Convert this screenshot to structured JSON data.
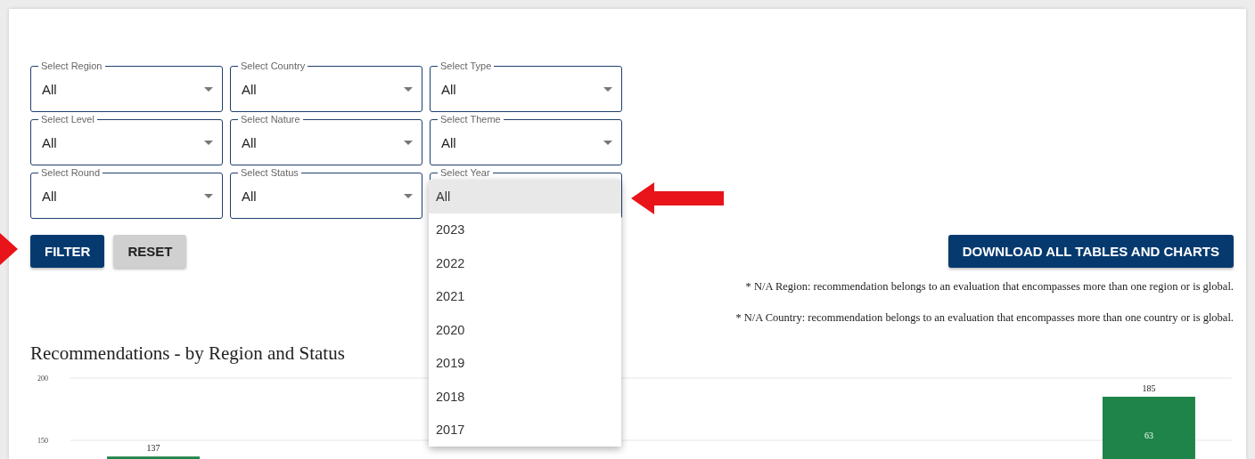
{
  "filters": [
    {
      "label": "Select Region",
      "value": "All"
    },
    {
      "label": "Select Country",
      "value": "All"
    },
    {
      "label": "Select Type",
      "value": "All"
    },
    {
      "label": "Select Level",
      "value": "All"
    },
    {
      "label": "Select Nature",
      "value": "All"
    },
    {
      "label": "Select Theme",
      "value": "All"
    },
    {
      "label": "Select Round",
      "value": "All"
    },
    {
      "label": "Select Status",
      "value": "All"
    },
    {
      "label": "Select Year",
      "expanded": true,
      "options": [
        {
          "label": "All",
          "selected": true
        },
        {
          "label": "2023",
          "selected": false
        },
        {
          "label": "2022",
          "selected": false
        },
        {
          "label": "2021",
          "selected": false
        },
        {
          "label": "2020",
          "selected": false
        },
        {
          "label": "2019",
          "selected": false
        },
        {
          "label": "2018",
          "selected": false
        },
        {
          "label": "2017",
          "selected": false
        }
      ]
    }
  ],
  "buttons": [
    {
      "label": "FILTER",
      "kind": "primary"
    },
    {
      "label": "RESET",
      "kind": "secondary"
    }
  ],
  "download_button": "DOWNLOAD ALL TABLES AND CHARTS",
  "notes": [
    "* N/A Region: recommendation belongs to an evaluation that encompasses more than one region or is global.",
    "* N/A Country: recommendation belongs to an evaluation that encompasses more than one country or is global."
  ],
  "chart": {
    "title": "Recommendations - by Region and Status",
    "chart_data": {
      "type": "bar",
      "data_labels": true,
      "ylim": [
        0,
        200
      ],
      "yticks": [
        150,
        200
      ],
      "categories": [
        null,
        null,
        null,
        null,
        null,
        null,
        null
      ],
      "series": [
        {
          "color": "#1e8449",
          "values": [
            137,
            null,
            null,
            null,
            null,
            null,
            185
          ]
        }
      ],
      "annotations": [
        "63"
      ]
    }
  }
}
